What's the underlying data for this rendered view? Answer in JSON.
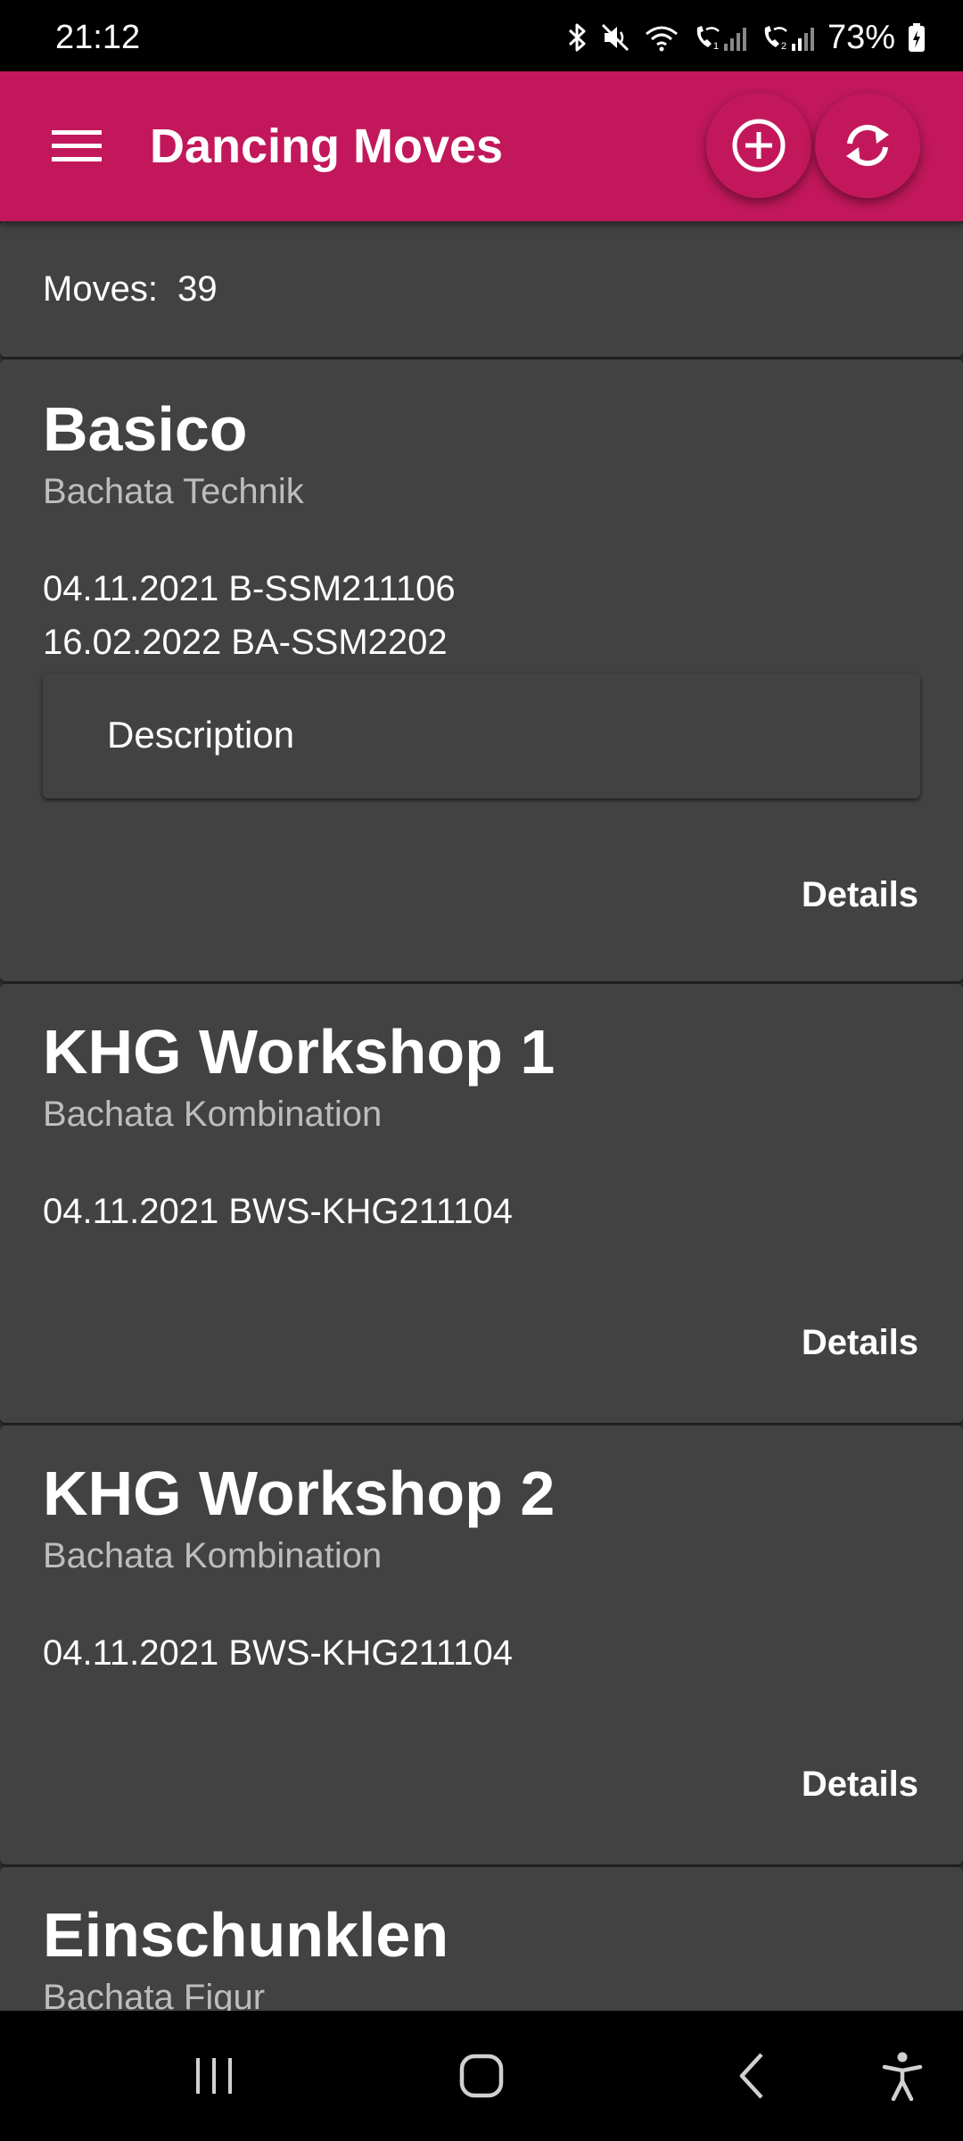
{
  "status_bar": {
    "time": "21:12",
    "battery": "73%",
    "icons": [
      "bluetooth-icon",
      "mute-icon",
      "wifi-icon",
      "wifi-call-1-icon",
      "wifi-call-2-icon",
      "battery-charging-icon"
    ]
  },
  "app_bar": {
    "title": "Dancing Moves",
    "background": "#c2185b",
    "menu_icon": "hamburger-menu-icon",
    "actions": [
      {
        "name": "add-move-button",
        "icon": "add-circle-icon"
      },
      {
        "name": "refresh-button",
        "icon": "sync-icon"
      }
    ]
  },
  "summary": {
    "label": "Moves:",
    "count": "39",
    "text": "Moves:  39"
  },
  "moves": [
    {
      "title": "Basico",
      "subtitle": "Bachata Technik",
      "sessions": [
        "04.11.2021 B-SSM211106",
        "16.02.2022 BA-SSM2202"
      ],
      "description_label": "Description",
      "details_label": "Details"
    },
    {
      "title": "KHG Workshop 1",
      "subtitle": "Bachata Kombination",
      "sessions": [
        "04.11.2021 BWS-KHG211104"
      ],
      "details_label": "Details"
    },
    {
      "title": "KHG Workshop 2",
      "subtitle": "Bachata Kombination",
      "sessions": [
        "04.11.2021 BWS-KHG211104"
      ],
      "details_label": "Details"
    },
    {
      "title": "Einschunklen",
      "subtitle": "Bachata Figur"
    }
  ],
  "nav_bar": {
    "buttons": [
      "recent-apps-icon",
      "home-icon",
      "back-icon",
      "accessibility-icon"
    ]
  }
}
